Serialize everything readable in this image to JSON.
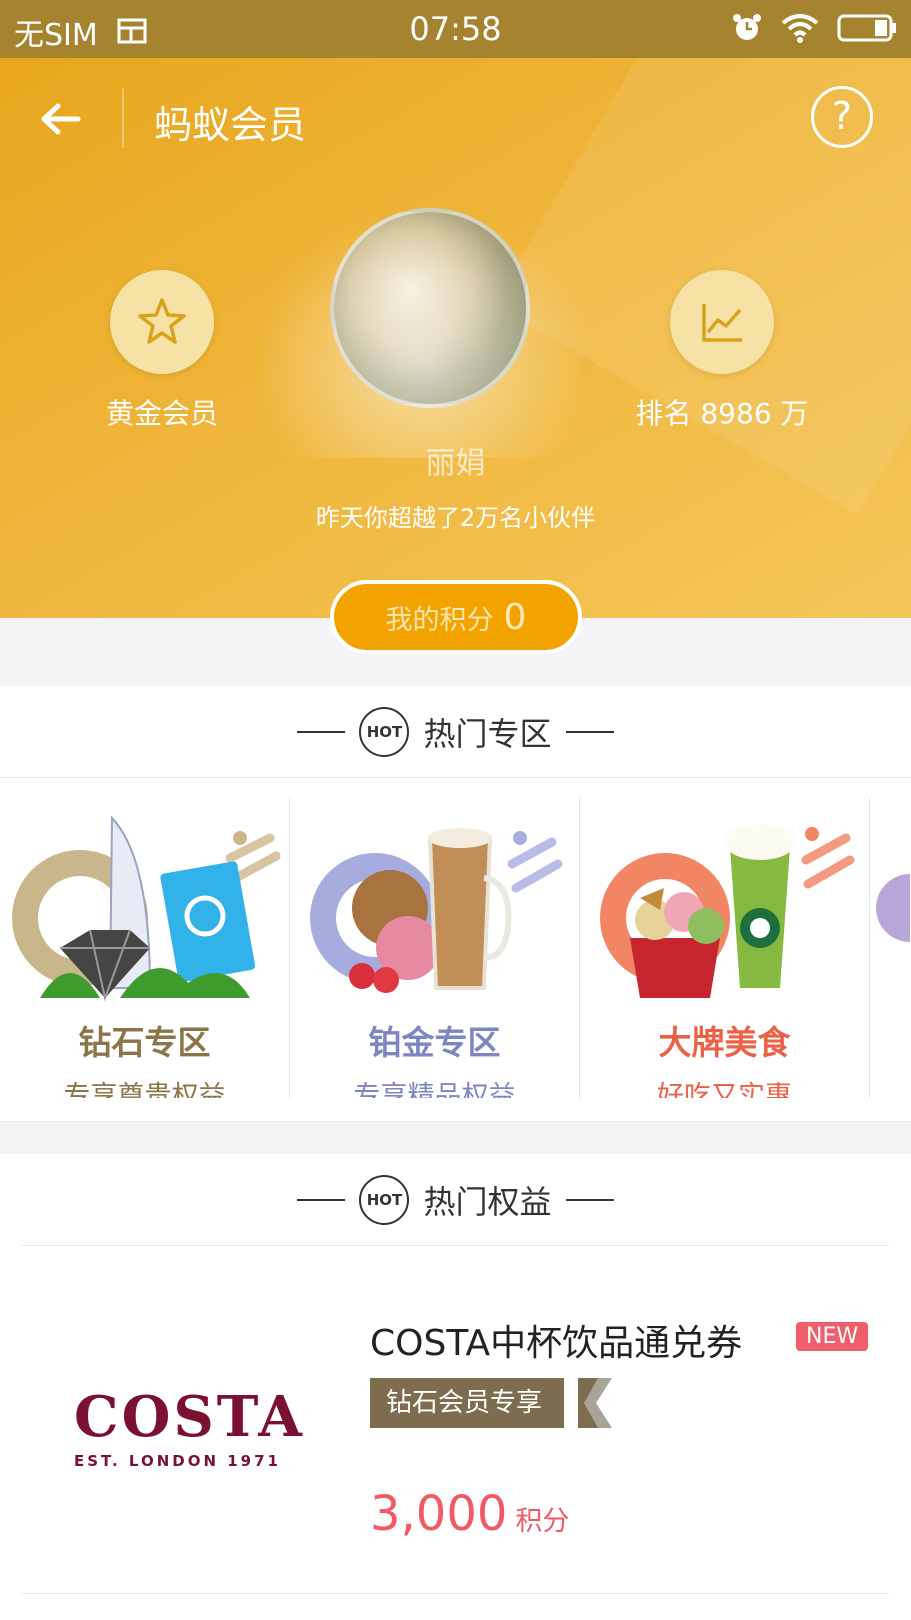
{
  "status_bar": {
    "carrier": "无SIM",
    "time": "07:58"
  },
  "header": {
    "title": "蚂蚁会员",
    "help_label": "?"
  },
  "profile": {
    "level_label": "黄金会员",
    "rank_label": "排名 8986 万",
    "username": "丽娟",
    "subtitle": "昨天你超越了2万名小伙伴",
    "points_label": "我的积分",
    "points_value": "0"
  },
  "hot_zones": {
    "heading": "热门专区",
    "hot_icon_text": "HOT",
    "items": [
      {
        "title": "钻石专区",
        "desc": "专享尊贵权益",
        "color": "#8a7448"
      },
      {
        "title": "铂金专区",
        "desc": "专享精品权益",
        "color": "#7e86c0"
      },
      {
        "title": "大牌美食",
        "desc": "好吃又实惠",
        "color": "#ea6246"
      }
    ]
  },
  "hot_benefits": {
    "heading": "热门权益",
    "hot_icon_text": "HOT",
    "item": {
      "logo_text": "COSTA",
      "logo_tagline": "EST. LONDON 1971",
      "title": "COSTA中杯饮品通兑券",
      "badge": "NEW",
      "ribbon": "钻石会员专享",
      "price": "3,000",
      "price_unit": "积分"
    }
  },
  "colors": {
    "header_gold": "#efb53a",
    "accent_orange": "#f3a300",
    "price_red": "#ef5a64"
  }
}
